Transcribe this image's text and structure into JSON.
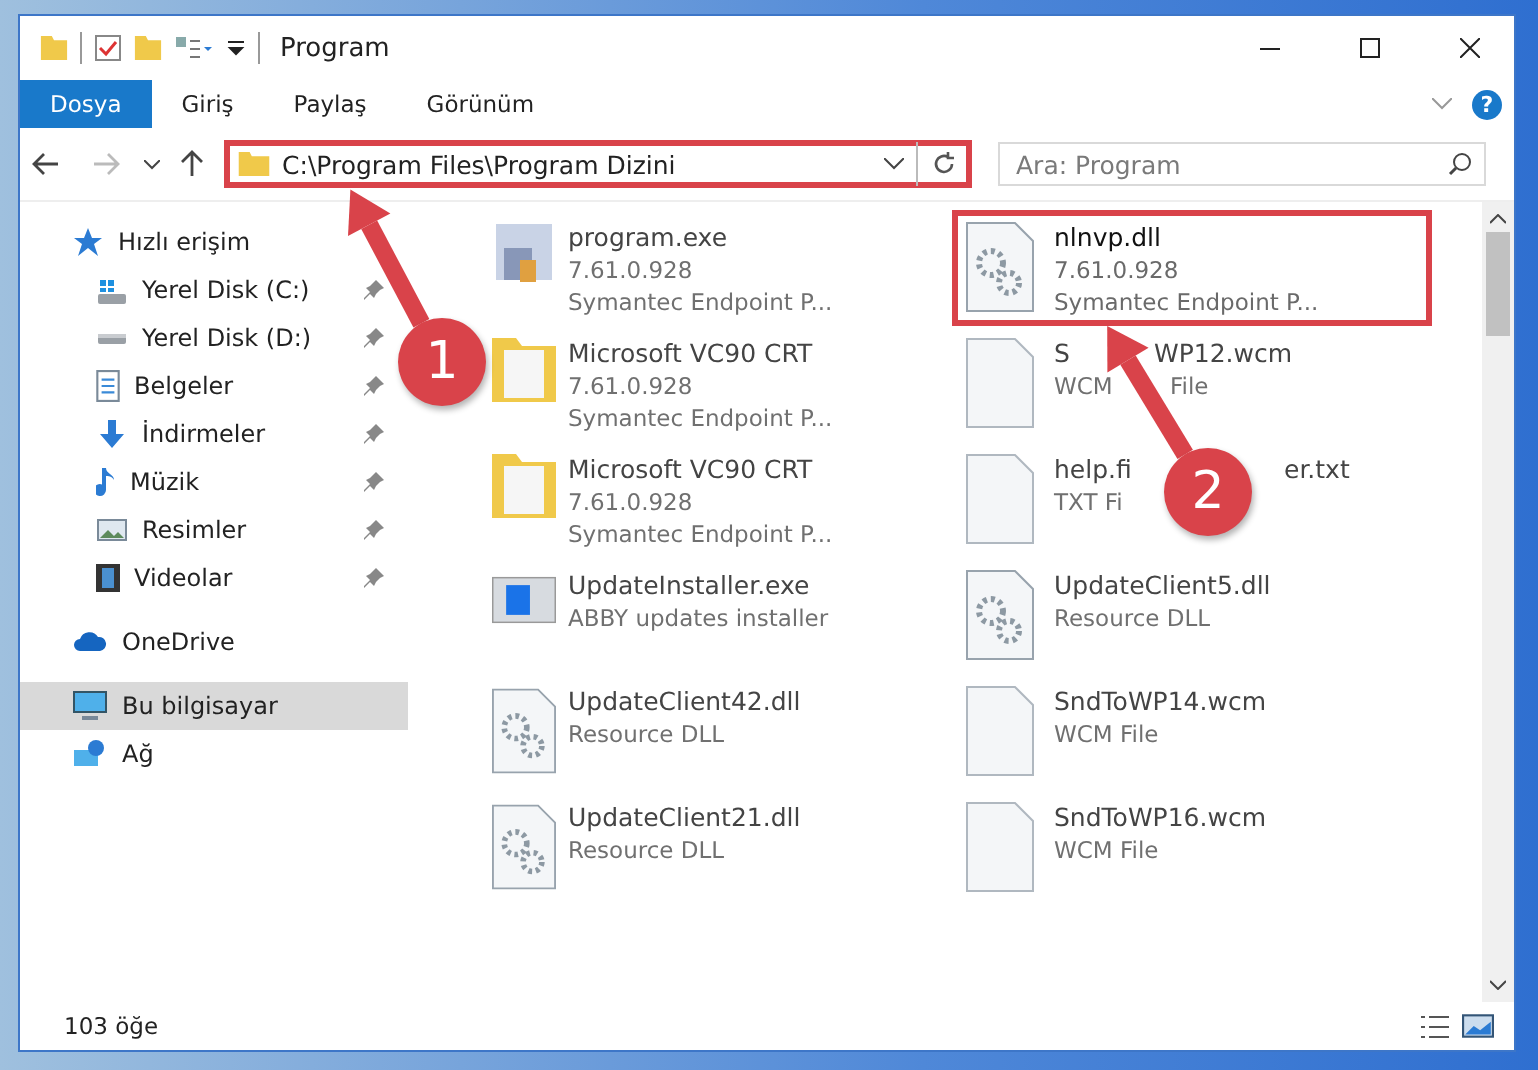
{
  "window": {
    "title": "Program"
  },
  "ribbon": {
    "tabs": [
      {
        "label": "Dosya",
        "selected": true
      },
      {
        "label": "Giriş",
        "selected": false
      },
      {
        "label": "Paylaş",
        "selected": false
      },
      {
        "label": "Görünüm",
        "selected": false
      }
    ],
    "help": "?"
  },
  "address_bar": {
    "path": "C:\\Program Files\\Program Dizini",
    "highlighted": true
  },
  "search": {
    "placeholder": "Ara: Program"
  },
  "sidebar": {
    "items": [
      {
        "label": "Hızlı erişim",
        "kind": "star",
        "pinned": false,
        "selected": false,
        "children": [
          {
            "label": "Yerel Disk (C:)",
            "kind": "drive-win",
            "pinned": true,
            "selected": false
          },
          {
            "label": "Yerel Disk (D:)",
            "kind": "drive",
            "pinned": true,
            "selected": false
          },
          {
            "label": "Belgeler",
            "kind": "doc",
            "pinned": true,
            "selected": false
          },
          {
            "label": "İndirmeler",
            "kind": "download",
            "pinned": true,
            "selected": false
          },
          {
            "label": "Müzik",
            "kind": "music",
            "pinned": true,
            "selected": false
          },
          {
            "label": "Resimler",
            "kind": "image",
            "pinned": true,
            "selected": false
          },
          {
            "label": "Videolar",
            "kind": "film",
            "pinned": true,
            "selected": false
          }
        ]
      },
      {
        "label": "OneDrive",
        "kind": "cloud",
        "pinned": false,
        "selected": false
      },
      {
        "label": "Bu bilgisayar",
        "kind": "monitor",
        "pinned": false,
        "selected": true
      },
      {
        "label": "Ağ",
        "kind": "network",
        "pinned": false,
        "selected": false
      }
    ]
  },
  "files": [
    {
      "name": [
        "program.exe"
      ],
      "lines": [
        [
          "7.61.0.928"
        ],
        [
          "Symantec Endpoint P..."
        ]
      ],
      "kind": "exe",
      "highlighted": false
    },
    {
      "name": [
        "nlnvp.dll"
      ],
      "lines": [
        [
          "7.61.0.928"
        ],
        [
          "Symantec Endpoint P..."
        ]
      ],
      "kind": "dll",
      "highlighted": true
    },
    {
      "name": [
        "Microsoft VC90 CRT"
      ],
      "lines": [
        [
          "7.61.0.928"
        ],
        [
          "Symantec Endpoint P..."
        ]
      ],
      "kind": "folder",
      "highlighted": false
    },
    {
      "name": [
        "S",
        "WP12.wcm"
      ],
      "lines": [
        [
          "WCM",
          "File"
        ]
      ],
      "kind": "file",
      "highlighted": false
    },
    {
      "name": [
        "Microsoft VC90 CRT"
      ],
      "lines": [
        [
          "7.61.0.928"
        ],
        [
          "Symantec Endpoint P..."
        ]
      ],
      "kind": "folder",
      "highlighted": false
    },
    {
      "name": [
        "help.fi",
        "er.txt"
      ],
      "lines": [
        [
          "TXT Fi"
        ]
      ],
      "kind": "file",
      "highlighted": false
    },
    {
      "name": [
        "UpdateInstaller.exe"
      ],
      "lines": [
        [
          "ABBY updates installer"
        ]
      ],
      "kind": "installer",
      "highlighted": false
    },
    {
      "name": [
        "UpdateClient5.dll"
      ],
      "lines": [
        [
          "Resource DLL"
        ]
      ],
      "kind": "dll",
      "highlighted": false
    },
    {
      "name": [
        "UpdateClient42.dll"
      ],
      "lines": [
        [
          "Resource DLL"
        ]
      ],
      "kind": "dll",
      "highlighted": false
    },
    {
      "name": [
        "SndToWP14.wcm"
      ],
      "lines": [
        [
          "WCM File"
        ]
      ],
      "kind": "file",
      "highlighted": false
    },
    {
      "name": [
        "UpdateClient21.dll"
      ],
      "lines": [
        [
          "Resource DLL"
        ]
      ],
      "kind": "dll",
      "highlighted": false
    },
    {
      "name": [
        "SndToWP16.wcm"
      ],
      "lines": [
        [
          "WCM File"
        ]
      ],
      "kind": "file",
      "highlighted": false
    }
  ],
  "status_bar": {
    "count": "103 öğe"
  },
  "annotations": [
    {
      "number": "1"
    },
    {
      "number": "2"
    }
  ]
}
